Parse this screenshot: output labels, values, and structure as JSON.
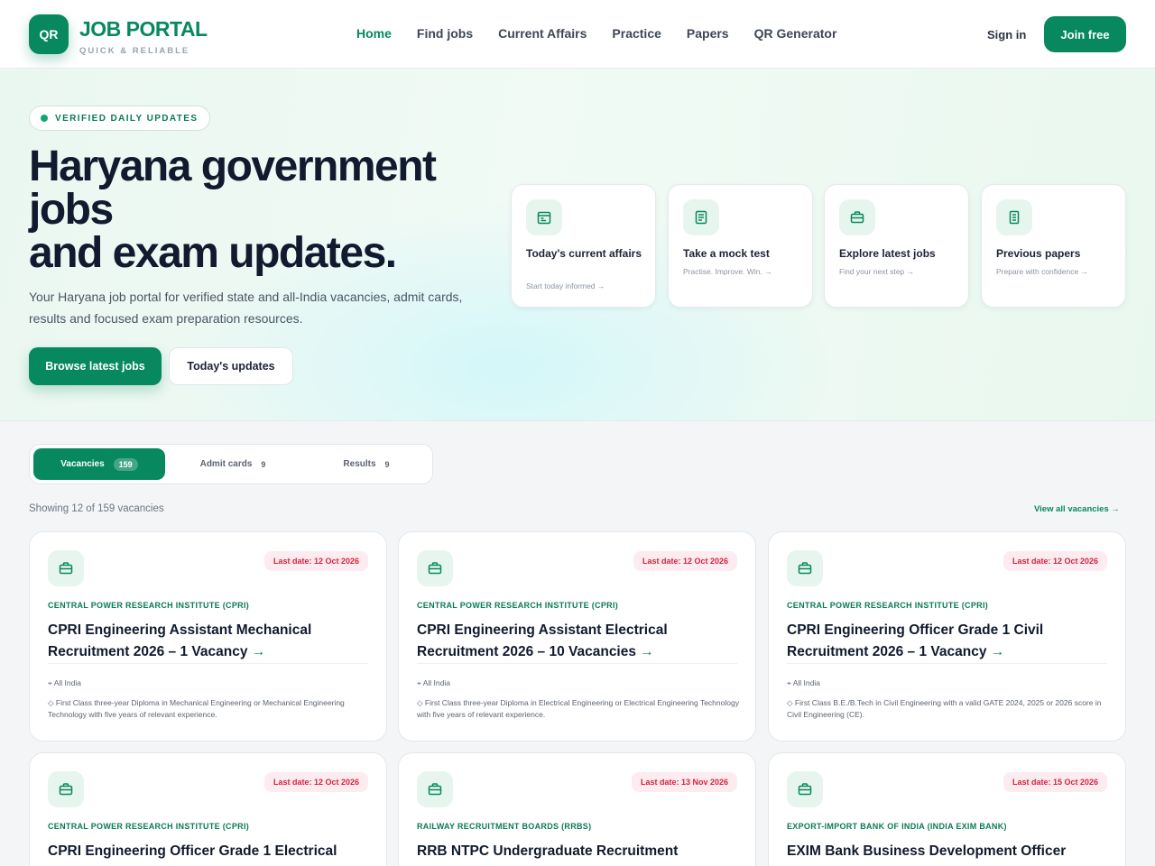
{
  "header": {
    "logo_badge": "QR",
    "logo_title": "JOB PORTAL",
    "logo_subtitle": "QUICK & RELIABLE",
    "nav": [
      "Home",
      "Find jobs",
      "Current Affairs",
      "Practice",
      "Papers",
      "QR Generator"
    ],
    "active_nav": "Home",
    "signin_label": "Sign in",
    "join_label": "Join free"
  },
  "hero": {
    "pill": "VERIFIED DAILY UPDATES",
    "title_line1": "Haryana government jobs",
    "title_line2": "and exam updates.",
    "description": "Your Haryana job portal for verified state and all-India vacancies, admit cards, results and focused exam preparation resources.",
    "primary_button": "Browse latest jobs",
    "secondary_button": "Today's updates",
    "quick_cards": [
      {
        "icon": "calendar-icon",
        "title": "Today's current affairs",
        "subtitle": "Start today informed →"
      },
      {
        "icon": "document-icon",
        "title": "Take a mock test",
        "subtitle": "Practise. Improve. Win. →"
      },
      {
        "icon": "briefcase-icon",
        "title": "Explore latest jobs",
        "subtitle": "Find your next step →"
      },
      {
        "icon": "papers-icon",
        "title": "Previous papers",
        "subtitle": "Prepare with confidence →"
      }
    ]
  },
  "tabs": [
    {
      "label": "Vacancies",
      "count": "159",
      "active": true
    },
    {
      "label": "Admit cards",
      "count": "9",
      "active": false
    },
    {
      "label": "Results",
      "count": "9",
      "active": false
    }
  ],
  "listing": {
    "showing": "Showing 12 of 159 vacancies",
    "view_all": "View all vacancies →"
  },
  "jobs": [
    {
      "last_date": "Last date: 12 Oct 2026",
      "org": "CENTRAL POWER RESEARCH INSTITUTE (CPRI)",
      "title": "CPRI Engineering Assistant Mechanical Recruitment 2026 – 1 Vacancy",
      "location": "All India",
      "qualification": "First Class three-year Diploma in Mechanical Engineering or Mechanical Engineering Technology with five years of relevant experience."
    },
    {
      "last_date": "Last date: 12 Oct 2026",
      "org": "CENTRAL POWER RESEARCH INSTITUTE (CPRI)",
      "title": "CPRI Engineering Assistant Electrical Recruitment 2026 – 10 Vacancies",
      "location": "All India",
      "qualification": "First Class three-year Diploma in Electrical Engineering or Electrical Engineering Technology with five years of relevant experience."
    },
    {
      "last_date": "Last date: 12 Oct 2026",
      "org": "CENTRAL POWER RESEARCH INSTITUTE (CPRI)",
      "title": "CPRI Engineering Officer Grade 1 Civil Recruitment 2026 – 1 Vacancy",
      "location": "All India",
      "qualification": "First Class B.E./B.Tech in Civil Engineering with a valid GATE 2024, 2025 or 2026 score in Civil Engineering (CE)."
    },
    {
      "last_date": "Last date: 12 Oct 2026",
      "org": "CENTRAL POWER RESEARCH INSTITUTE (CPRI)",
      "title": "CPRI Engineering Officer Grade 1 Electrical",
      "location": "",
      "qualification": ""
    },
    {
      "last_date": "Last date: 13 Nov 2026",
      "org": "RAILWAY RECRUITMENT BOARDS (RRBS)",
      "title": "RRB NTPC Undergraduate Recruitment",
      "location": "",
      "qualification": ""
    },
    {
      "last_date": "Last date: 15 Oct 2026",
      "org": "EXPORT-IMPORT BANK OF INDIA (INDIA EXIM BANK)",
      "title": "EXIM Bank Business Development Officer",
      "location": "",
      "qualification": ""
    }
  ],
  "colors": {
    "brand": "#07885f",
    "deadline": "#d4233f",
    "text": "#111a2e"
  }
}
